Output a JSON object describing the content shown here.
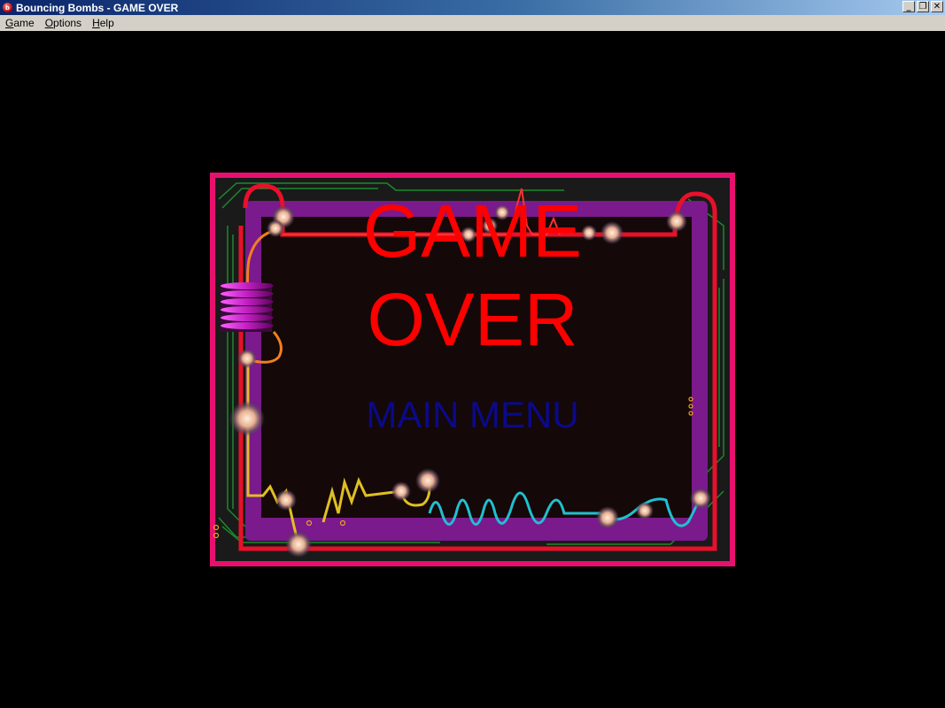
{
  "window": {
    "title": "Bouncing Bombs - GAME OVER",
    "icon": "bomb-app-icon",
    "controls": [
      "minimize",
      "restore",
      "close"
    ]
  },
  "menubar": {
    "items": [
      {
        "label": "Game",
        "accel": "G"
      },
      {
        "label": "Options",
        "accel": "O"
      },
      {
        "label": "Help",
        "accel": "H"
      }
    ]
  },
  "screen": {
    "heading_line1": "GAME",
    "heading_line2": "OVER",
    "main_menu_label": "MAIN MENU"
  },
  "colors": {
    "frame_pink": "#e8106e",
    "wire_red": "#e8102a",
    "inner_purple": "#7a1a8c",
    "heading_red": "#ff0000",
    "menu_blue": "#0a0a8a",
    "wire_yellow": "#e0c020",
    "wire_cyan": "#20c0d0",
    "coil_magenta": "#c020c0"
  }
}
